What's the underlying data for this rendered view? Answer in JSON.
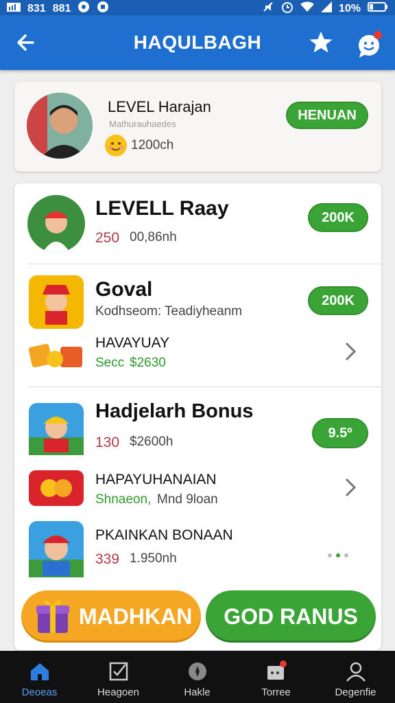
{
  "status_bar": {
    "left_text_1": "831",
    "left_text_2": "881",
    "battery": "10%"
  },
  "app_bar": {
    "title": "HAQULBAGH"
  },
  "profile": {
    "name": "LEVEL Harajan",
    "subtitle": "Mathurauhaedes",
    "coins": "1200ch",
    "button": "HENUAN"
  },
  "list": [
    {
      "title": "LEVELL Raay",
      "meta_1": "250",
      "meta_2": "00,86nh",
      "badge": "200K"
    },
    {
      "title": "Goval",
      "subtitle": "Kodhseom: Teadiyheanm",
      "badge": "200K"
    },
    {
      "title": "HAVAYUAY",
      "meta_1": "Secc",
      "meta_2": "$2630"
    },
    {
      "title": "Hadjelarh Bonus",
      "meta_1": "130",
      "meta_2": "$2600h",
      "badge": "9.5º"
    },
    {
      "title": "HAPAYUHANAIAN",
      "meta_1": "Shnaeon,",
      "meta_2": "Mnd 9loan"
    },
    {
      "title": "PKAINKAN BONAAN",
      "meta_1": "339",
      "meta_2": "1.950nh"
    }
  ],
  "cta": {
    "left": "MADHKAN",
    "right": "GOD RANUS"
  },
  "bottom_nav": [
    {
      "label": "Deoeas"
    },
    {
      "label": "Heagoen"
    },
    {
      "label": "Hakle"
    },
    {
      "label": "Torree"
    },
    {
      "label": "Degenfie"
    }
  ],
  "colors": {
    "primary": "#1f6fd1",
    "accent_green": "#3aa536",
    "accent_orange": "#f5a623"
  }
}
